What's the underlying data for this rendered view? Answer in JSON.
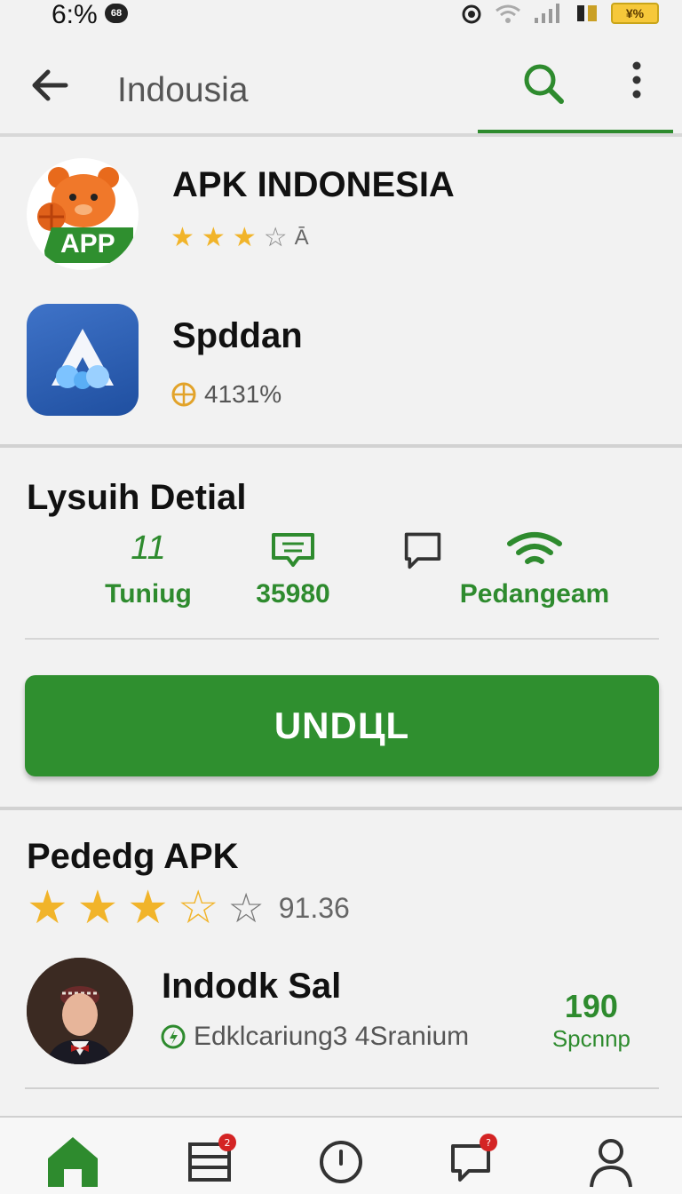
{
  "status_bar": {
    "time": "6:%",
    "notification": "68",
    "battery": "¥%"
  },
  "app_bar": {
    "title": "Indousia"
  },
  "apps": [
    {
      "name": "APK INDONESIA",
      "icon_label": "APP",
      "rating": 3,
      "rating_max": 4,
      "meta": "Ā"
    },
    {
      "name": "Spddan",
      "meta": "4131%"
    }
  ],
  "detail": {
    "title": "Lysuih Detial",
    "stats": [
      {
        "icon": "11",
        "label": "Tuniug"
      },
      {
        "icon": "chat-bubble-icon",
        "label": "35980"
      },
      {
        "icon": "speech-bubble-icon",
        "label": ""
      },
      {
        "icon": "wifi-icon",
        "label": "Pedangeam"
      }
    ],
    "download_label": "UNDЦL"
  },
  "review": {
    "title": "Pededg APK",
    "rating": 3,
    "rating_max": 5,
    "rating_value": "91.36",
    "reviewer_name": "Indodk Sal",
    "reviewer_sub": "Edklcariung3 4Sranium",
    "count": "190",
    "count_label": "Spcnnp"
  },
  "colors": {
    "accent": "#2e8b2e",
    "star": "#f1b42a"
  },
  "nav": {
    "items": [
      "home-icon",
      "list-icon",
      "clock-icon",
      "chat-icon",
      "profile-icon"
    ]
  }
}
